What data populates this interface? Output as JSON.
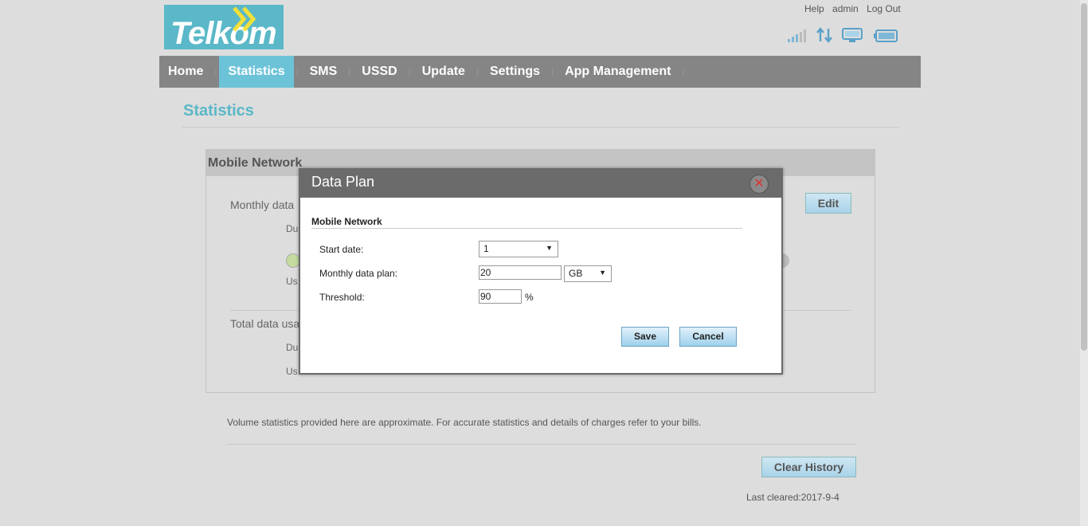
{
  "brand": {
    "logo_text": "Telkom",
    "color": "#5bb8c8"
  },
  "top_links": {
    "help": "Help",
    "user": "admin",
    "logout": "Log Out"
  },
  "status_icons": [
    "signal-icon",
    "data-transfer-icon",
    "monitor-icon",
    "battery-icon"
  ],
  "nav": {
    "items": [
      {
        "label": "Home"
      },
      {
        "label": "Statistics",
        "active": true
      },
      {
        "label": "SMS"
      },
      {
        "label": "USSD"
      },
      {
        "label": "Update"
      },
      {
        "label": "Settings"
      },
      {
        "label": "App Management"
      }
    ]
  },
  "page": {
    "title": "Statistics"
  },
  "panel": {
    "title": "Mobile Network",
    "monthly_label": "Monthly data",
    "duration_short": "Du",
    "used_short": "Us",
    "total_label": "Total data usa",
    "duration_short_2": "Du",
    "used_short_2": "Us",
    "edit_label": "Edit"
  },
  "note": "Volume statistics provided here are approximate. For accurate statistics and details of charges refer to your bills.",
  "clear_history_label": "Clear History",
  "last_cleared": "Last cleared:2017-9-4",
  "modal": {
    "title": "Data Plan",
    "close_symbol": "✕",
    "section": "Mobile Network",
    "start_date_label": "Start date:",
    "start_date_value": "1",
    "monthly_plan_label": "Monthly data plan:",
    "monthly_plan_value": "20",
    "unit_value": "GB",
    "threshold_label": "Threshold:",
    "threshold_value": "90",
    "threshold_unit": "%",
    "save_label": "Save",
    "cancel_label": "Cancel"
  }
}
